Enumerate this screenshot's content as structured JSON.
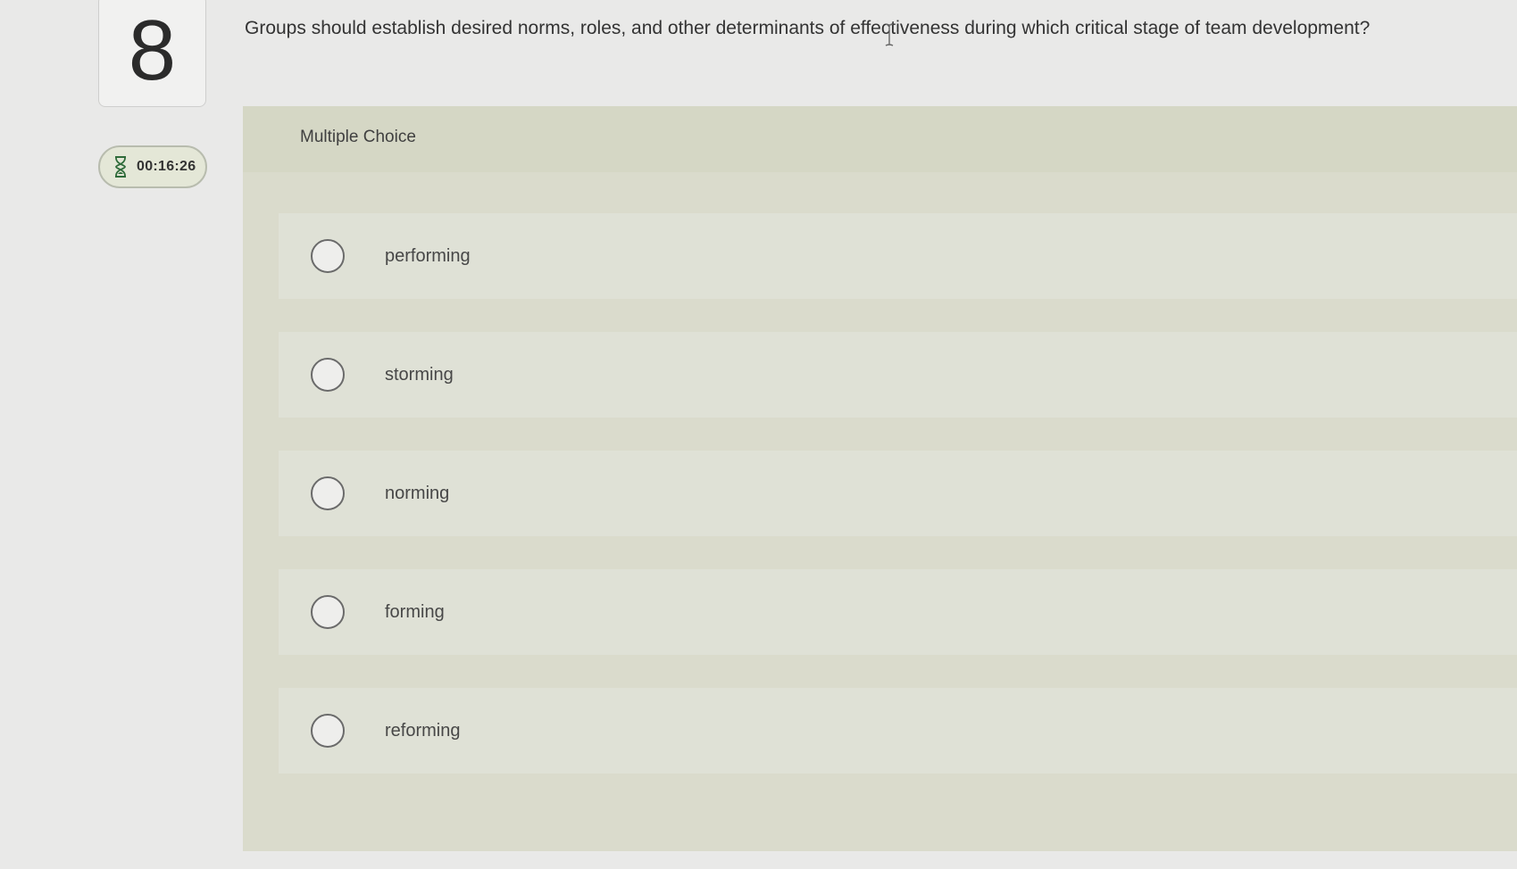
{
  "question": {
    "number": "8",
    "text": "Groups should establish desired norms, roles, and other determinants of effectiveness during which critical stage of team development?"
  },
  "timer": {
    "icon": "hourglass-icon",
    "time": "00:16:26"
  },
  "choices": {
    "label": "Multiple Choice",
    "options": [
      {
        "label": "performing"
      },
      {
        "label": "storming"
      },
      {
        "label": "norming"
      },
      {
        "label": "forming"
      },
      {
        "label": "reforming"
      }
    ]
  },
  "colors": {
    "page_background": "#e9e9e8",
    "panel_background": "#dadbcc",
    "option_background": "#dfe1d6",
    "timer_background": "#e4e7d7"
  }
}
